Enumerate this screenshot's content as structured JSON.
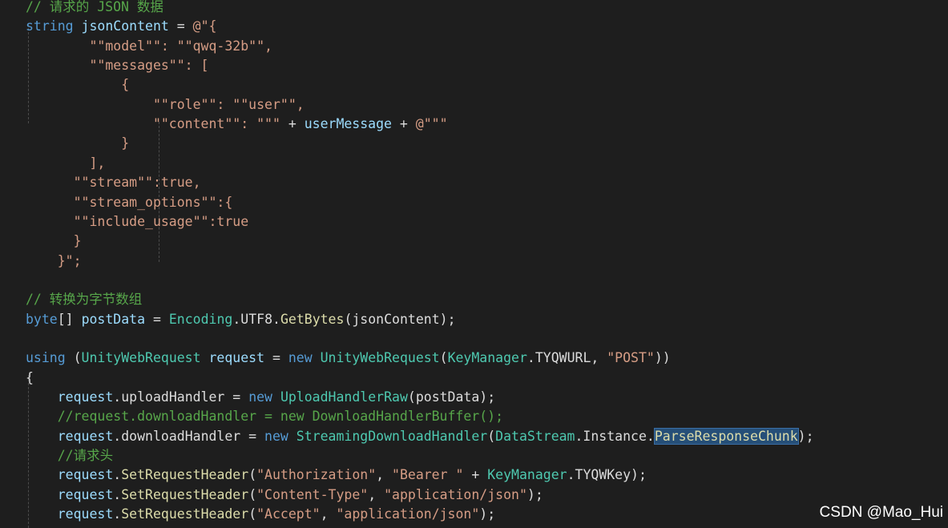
{
  "code_lines": [
    [
      {
        "t": "// 请求的 JSON 数据",
        "c": "cm"
      }
    ],
    [
      {
        "t": "string ",
        "c": "kw"
      },
      {
        "t": "jsonContent",
        "c": "vr"
      },
      {
        "t": " = ",
        "c": "pl"
      },
      {
        "t": "@\"{",
        "c": "st"
      }
    ],
    [
      {
        "t": "        \"\"model\"\": \"\"qwq-32b\"\",",
        "c": "st"
      }
    ],
    [
      {
        "t": "        \"\"messages\"\": [",
        "c": "st"
      }
    ],
    [
      {
        "t": "            {",
        "c": "st"
      }
    ],
    [
      {
        "t": "                \"\"role\"\": \"\"user\"\",",
        "c": "st"
      }
    ],
    [
      {
        "t": "                \"\"content\"\": \"\"\"",
        "c": "st"
      },
      {
        "t": " + ",
        "c": "pl"
      },
      {
        "t": "userMessage",
        "c": "vr"
      },
      {
        "t": " + ",
        "c": "pl"
      },
      {
        "t": "@\"\"\"",
        "c": "st"
      }
    ],
    [
      {
        "t": "            }",
        "c": "st"
      }
    ],
    [
      {
        "t": "        ],",
        "c": "st"
      }
    ],
    [
      {
        "t": "      \"\"stream\"\":true,",
        "c": "st"
      }
    ],
    [
      {
        "t": "      \"\"stream_options\"\":{",
        "c": "st"
      }
    ],
    [
      {
        "t": "      \"\"include_usage\"\":true",
        "c": "st"
      }
    ],
    [
      {
        "t": "      }",
        "c": "st"
      }
    ],
    [
      {
        "t": "    }\";",
        "c": "st"
      }
    ],
    [],
    [
      {
        "t": "// 转换为字节数组",
        "c": "cm"
      }
    ],
    [
      {
        "t": "byte",
        "c": "kw"
      },
      {
        "t": "[] ",
        "c": "pl"
      },
      {
        "t": "postData",
        "c": "vr"
      },
      {
        "t": " = ",
        "c": "pl"
      },
      {
        "t": "Encoding",
        "c": "ty"
      },
      {
        "t": ".UTF8.",
        "c": "pl"
      },
      {
        "t": "GetBytes",
        "c": "mt"
      },
      {
        "t": "(jsonContent);",
        "c": "pl"
      }
    ],
    [],
    [
      {
        "t": "using",
        "c": "kw"
      },
      {
        "t": " (",
        "c": "pl"
      },
      {
        "t": "UnityWebRequest",
        "c": "ty"
      },
      {
        "t": " ",
        "c": "pl"
      },
      {
        "t": "request",
        "c": "vr"
      },
      {
        "t": " = ",
        "c": "pl"
      },
      {
        "t": "new ",
        "c": "kw"
      },
      {
        "t": "UnityWebRequest",
        "c": "ty"
      },
      {
        "t": "(",
        "c": "pl"
      },
      {
        "t": "KeyManager",
        "c": "ty"
      },
      {
        "t": ".TYQWURL, ",
        "c": "pl"
      },
      {
        "t": "\"POST\"",
        "c": "st"
      },
      {
        "t": "))",
        "c": "pl"
      }
    ],
    [
      {
        "t": "{",
        "c": "pl"
      }
    ],
    [
      {
        "t": "    ",
        "c": "pl"
      },
      {
        "t": "request",
        "c": "vr"
      },
      {
        "t": ".uploadHandler = ",
        "c": "pl"
      },
      {
        "t": "new ",
        "c": "kw"
      },
      {
        "t": "UploadHandlerRaw",
        "c": "ty"
      },
      {
        "t": "(postData);",
        "c": "pl"
      }
    ],
    [
      {
        "t": "    //request.downloadHandler = new DownloadHandlerBuffer();",
        "c": "cm"
      }
    ],
    [
      {
        "t": "    ",
        "c": "pl"
      },
      {
        "t": "request",
        "c": "vr"
      },
      {
        "t": ".downloadHandler = ",
        "c": "pl"
      },
      {
        "t": "new ",
        "c": "kw"
      },
      {
        "t": "StreamingDownloadHandler",
        "c": "ty"
      },
      {
        "t": "(",
        "c": "pl"
      },
      {
        "t": "DataStream",
        "c": "ty"
      },
      {
        "t": ".Instance.",
        "c": "pl"
      },
      {
        "t": "ParseResponseChunk",
        "c": "mt",
        "sel": true
      },
      {
        "t": ");",
        "c": "pl"
      }
    ],
    [
      {
        "t": "    //请求头",
        "c": "cm"
      }
    ],
    [
      {
        "t": "    ",
        "c": "pl"
      },
      {
        "t": "request",
        "c": "vr"
      },
      {
        "t": ".",
        "c": "pl"
      },
      {
        "t": "SetRequestHeader",
        "c": "mt"
      },
      {
        "t": "(",
        "c": "pl"
      },
      {
        "t": "\"Authorization\"",
        "c": "st"
      },
      {
        "t": ", ",
        "c": "pl"
      },
      {
        "t": "\"Bearer \"",
        "c": "st"
      },
      {
        "t": " + ",
        "c": "pl"
      },
      {
        "t": "KeyManager",
        "c": "ty"
      },
      {
        "t": ".TYQWKey);",
        "c": "pl"
      }
    ],
    [
      {
        "t": "    ",
        "c": "pl"
      },
      {
        "t": "request",
        "c": "vr"
      },
      {
        "t": ".",
        "c": "pl"
      },
      {
        "t": "SetRequestHeader",
        "c": "mt"
      },
      {
        "t": "(",
        "c": "pl"
      },
      {
        "t": "\"Content-Type\"",
        "c": "st"
      },
      {
        "t": ", ",
        "c": "pl"
      },
      {
        "t": "\"application/json\"",
        "c": "st"
      },
      {
        "t": ");",
        "c": "pl"
      }
    ],
    [
      {
        "t": "    ",
        "c": "pl"
      },
      {
        "t": "request",
        "c": "vr"
      },
      {
        "t": ".",
        "c": "pl"
      },
      {
        "t": "SetRequestHeader",
        "c": "mt"
      },
      {
        "t": "(",
        "c": "pl"
      },
      {
        "t": "\"Accept\"",
        "c": "st"
      },
      {
        "t": ", ",
        "c": "pl"
      },
      {
        "t": "\"application/json\"",
        "c": "st"
      },
      {
        "t": ");",
        "c": "pl"
      }
    ]
  ],
  "watermark": "CSDN @Mao_Hui",
  "theme": {
    "background": "#1e1e1e",
    "keyword": "#569cd6",
    "type": "#4ec9b0",
    "string": "#d69d85",
    "comment": "#57a64a",
    "variable": "#9cdcfe",
    "method": "#dcdcaa",
    "selection": "#264f78"
  }
}
